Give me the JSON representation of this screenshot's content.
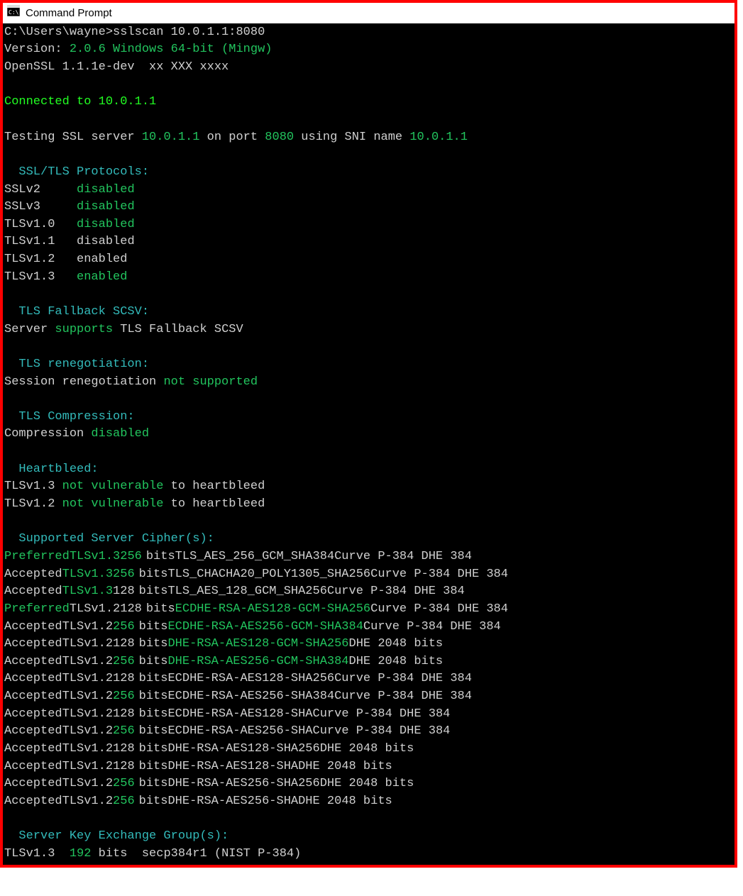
{
  "title": "Command Prompt",
  "prompt": "C:\\Users\\wayne>",
  "command": "sslscan 10.0.1.1:8080",
  "version_label": "Version:",
  "version_value": "2.0.6 Windows 64-bit (Mingw)",
  "openssl": "OpenSSL 1.1.1e-dev  xx XXX xxxx",
  "connected_prefix": "Connected to ",
  "connected_ip": "10.0.1.1",
  "testing_l1": "Testing SSL server ",
  "testing_ip": "10.0.1.1",
  "testing_l2": " on port ",
  "testing_port": "8080",
  "testing_l3": " using SNI name ",
  "testing_sni": "10.0.1.1",
  "section_protocols": "  SSL/TLS Protocols:",
  "protocols": [
    {
      "name": "SSLv2",
      "pad": "     ",
      "status": "disabled",
      "status_green": true
    },
    {
      "name": "SSLv3",
      "pad": "     ",
      "status": "disabled",
      "status_green": true
    },
    {
      "name": "TLSv1.0",
      "pad": "   ",
      "status": "disabled",
      "status_green": true
    },
    {
      "name": "TLSv1.1",
      "pad": "   ",
      "status": "disabled",
      "status_green": false
    },
    {
      "name": "TLSv1.2",
      "pad": "   ",
      "status": "enabled",
      "status_green": false
    },
    {
      "name": "TLSv1.3",
      "pad": "   ",
      "status": "enabled",
      "status_green": true
    }
  ],
  "section_fallback": "  TLS Fallback SCSV:",
  "fallback_l1": "Server ",
  "fallback_word": "supports",
  "fallback_l2": " TLS Fallback SCSV",
  "section_reneg": "  TLS renegotiation:",
  "reneg_l1": "Session renegotiation ",
  "reneg_word": "not supported",
  "section_comp": "  TLS Compression:",
  "comp_l1": "Compression ",
  "comp_word": "disabled",
  "section_heart": "  Heartbleed:",
  "heart": [
    {
      "proto": "TLSv1.3 ",
      "word": "not vulnerable",
      "tail": " to heartbleed"
    },
    {
      "proto": "TLSv1.2 ",
      "word": "not vulnerable",
      "tail": " to heartbleed"
    }
  ],
  "section_ciphers": "  Supported Server Cipher(s):",
  "ciphers": [
    {
      "status": "Preferred",
      "status_green": true,
      "proto": "TLSv1.3",
      "proto_green": true,
      "bits": "256",
      "bits_green": true,
      "name": "TLS_AES_256_GCM_SHA384",
      "name_green": false,
      "curve": "Curve P-384 DHE 384"
    },
    {
      "status": "Accepted",
      "status_green": false,
      "proto": "TLSv1.3",
      "proto_green": true,
      "bits": "256",
      "bits_green": true,
      "name": "TLS_CHACHA20_POLY1305_SHA256",
      "name_green": false,
      "curve": "Curve P-384 DHE 384"
    },
    {
      "status": "Accepted",
      "status_green": false,
      "proto": "TLSv1.3",
      "proto_green": true,
      "bits": "128",
      "bits_green": false,
      "name": "TLS_AES_128_GCM_SHA256",
      "name_green": false,
      "curve": "Curve P-384 DHE 384"
    },
    {
      "status": "Preferred",
      "status_green": true,
      "proto": "TLSv1.2",
      "proto_green": false,
      "bits": "128",
      "bits_green": false,
      "name": "ECDHE-RSA-AES128-GCM-SHA256",
      "name_green": true,
      "curve": "Curve P-384 DHE 384"
    },
    {
      "status": "Accepted",
      "status_green": false,
      "proto": "TLSv1.2",
      "proto_green": false,
      "bits": "256",
      "bits_green": true,
      "name": "ECDHE-RSA-AES256-GCM-SHA384",
      "name_green": true,
      "curve": "Curve P-384 DHE 384"
    },
    {
      "status": "Accepted",
      "status_green": false,
      "proto": "TLSv1.2",
      "proto_green": false,
      "bits": "128",
      "bits_green": false,
      "name": "DHE-RSA-AES128-GCM-SHA256",
      "name_green": true,
      "curve": "DHE 2048 bits"
    },
    {
      "status": "Accepted",
      "status_green": false,
      "proto": "TLSv1.2",
      "proto_green": false,
      "bits": "256",
      "bits_green": true,
      "name": "DHE-RSA-AES256-GCM-SHA384",
      "name_green": true,
      "curve": "DHE 2048 bits"
    },
    {
      "status": "Accepted",
      "status_green": false,
      "proto": "TLSv1.2",
      "proto_green": false,
      "bits": "128",
      "bits_green": false,
      "name": "ECDHE-RSA-AES128-SHA256",
      "name_green": false,
      "curve": "Curve P-384 DHE 384"
    },
    {
      "status": "Accepted",
      "status_green": false,
      "proto": "TLSv1.2",
      "proto_green": false,
      "bits": "256",
      "bits_green": true,
      "name": "ECDHE-RSA-AES256-SHA384",
      "name_green": false,
      "curve": "Curve P-384 DHE 384"
    },
    {
      "status": "Accepted",
      "status_green": false,
      "proto": "TLSv1.2",
      "proto_green": false,
      "bits": "128",
      "bits_green": false,
      "name": "ECDHE-RSA-AES128-SHA",
      "name_green": false,
      "curve": "Curve P-384 DHE 384"
    },
    {
      "status": "Accepted",
      "status_green": false,
      "proto": "TLSv1.2",
      "proto_green": false,
      "bits": "256",
      "bits_green": true,
      "name": "ECDHE-RSA-AES256-SHA",
      "name_green": false,
      "curve": "Curve P-384 DHE 384"
    },
    {
      "status": "Accepted",
      "status_green": false,
      "proto": "TLSv1.2",
      "proto_green": false,
      "bits": "128",
      "bits_green": false,
      "name": "DHE-RSA-AES128-SHA256",
      "name_green": false,
      "curve": "DHE 2048 bits"
    },
    {
      "status": "Accepted",
      "status_green": false,
      "proto": "TLSv1.2",
      "proto_green": false,
      "bits": "128",
      "bits_green": false,
      "name": "DHE-RSA-AES128-SHA",
      "name_green": false,
      "curve": "DHE 2048 bits"
    },
    {
      "status": "Accepted",
      "status_green": false,
      "proto": "TLSv1.2",
      "proto_green": false,
      "bits": "256",
      "bits_green": true,
      "name": "DHE-RSA-AES256-SHA256",
      "name_green": false,
      "curve": "DHE 2048 bits"
    },
    {
      "status": "Accepted",
      "status_green": false,
      "proto": "TLSv1.2",
      "proto_green": false,
      "bits": "256",
      "bits_green": true,
      "name": "DHE-RSA-AES256-SHA",
      "name_green": false,
      "curve": "DHE 2048 bits"
    }
  ],
  "section_kex": "  Server Key Exchange Group(s):",
  "kex_proto": "TLSv1.3  ",
  "kex_bits": "192",
  "kex_bitslbl": " bits  ",
  "kex_name": "secp384r1 (NIST P-384)",
  "bits_label": "bits"
}
